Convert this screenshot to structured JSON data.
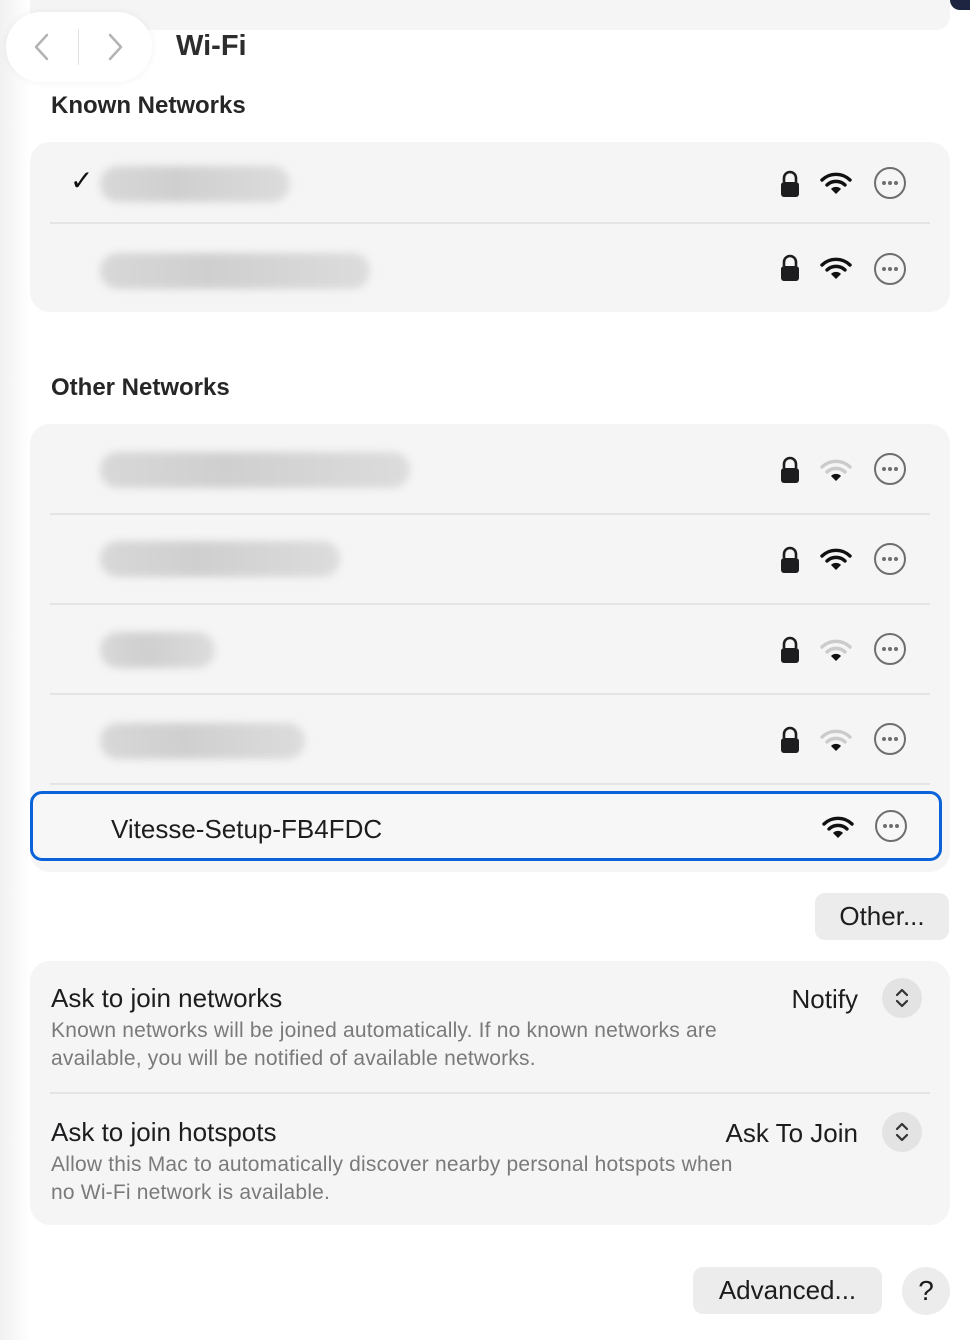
{
  "window": {
    "title": "Wi-Fi"
  },
  "nav": {
    "back_icon": "chevron-left-icon",
    "forward_icon": "chevron-right-icon"
  },
  "known_networks": {
    "heading": "Known Networks",
    "items": [
      {
        "name": "",
        "connected": true,
        "secured": true,
        "signal": "strong"
      },
      {
        "name": "",
        "connected": false,
        "secured": true,
        "signal": "strong"
      }
    ]
  },
  "other_networks": {
    "heading": "Other Networks",
    "items": [
      {
        "name": "",
        "secured": true,
        "signal": "weak"
      },
      {
        "name": "",
        "secured": true,
        "signal": "strong"
      },
      {
        "name": "",
        "secured": true,
        "signal": "weak"
      },
      {
        "name": "",
        "secured": true,
        "signal": "weak"
      },
      {
        "name": "Vitesse-Setup-FB4FDC",
        "secured": false,
        "signal": "strong",
        "selected": true
      }
    ],
    "other_button": "Other..."
  },
  "settings": {
    "ask_join_networks": {
      "title": "Ask to join networks",
      "description": "Known networks will be joined automatically. If no known networks are available, you will be notified of available networks.",
      "value": "Notify"
    },
    "ask_join_hotspots": {
      "title": "Ask to join hotspots",
      "description": "Allow this Mac to automatically discover nearby personal hotspots when no Wi-Fi network is available.",
      "value": "Ask To Join"
    }
  },
  "footer": {
    "advanced_button": "Advanced...",
    "help_button": "?"
  },
  "colors": {
    "accent": "#0a63d8",
    "group_bg": "#f5f5f5",
    "weak_signal": "#c8c8c8"
  }
}
